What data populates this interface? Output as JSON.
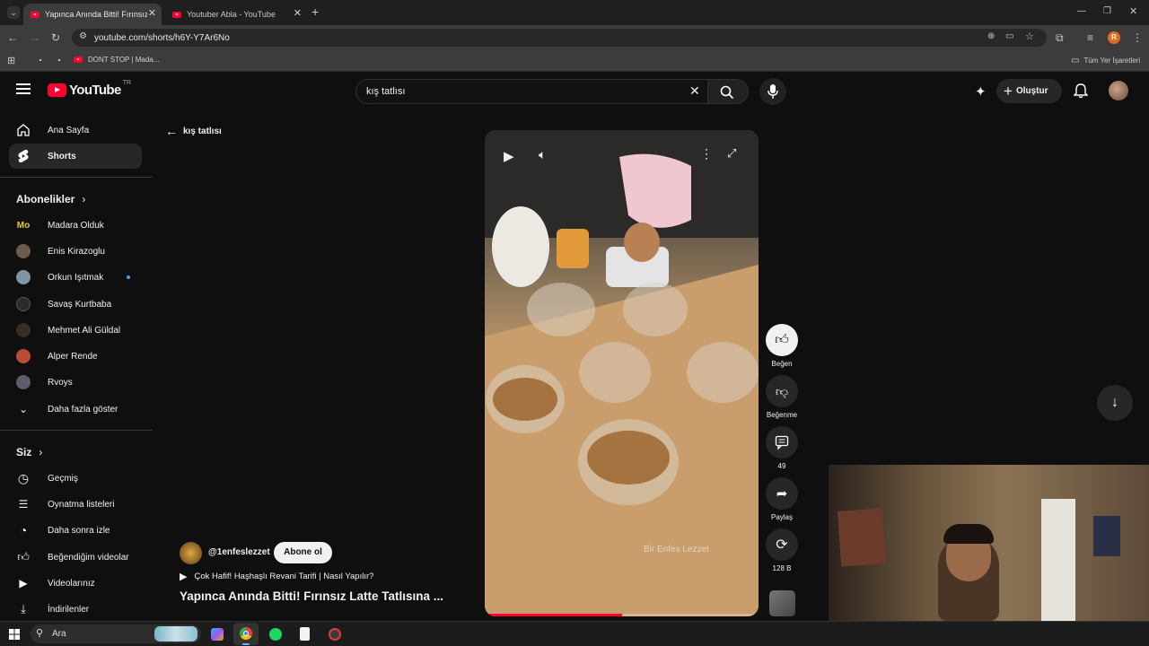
{
  "browser": {
    "tabs": [
      {
        "title": "Yapınca Anında Bitti! Fırınsız Lat",
        "active": true
      },
      {
        "title": "Youtuber Abla - YouTube",
        "active": false
      }
    ],
    "new_tab": "+",
    "url": "youtube.com/shorts/h6Y-Y7Ar6No",
    "profile_initial": "R",
    "bookmarks": [
      {
        "label": "",
        "type": "youtube"
      },
      {
        "label": "",
        "type": "youtube"
      },
      {
        "label": "DONT STOP | Mada...",
        "type": "youtube"
      }
    ],
    "all_bookmarks": "Tüm Yer İşaretleri"
  },
  "youtube": {
    "logo_text": "YouTube",
    "region": "TR",
    "search_value": "kış tatlısı",
    "create_label": "Oluştur",
    "back_label": "kış tatlısı",
    "sidebar": {
      "main": [
        {
          "label": "Ana Sayfa",
          "icon": "home-icon",
          "active": false
        },
        {
          "label": "Shorts",
          "icon": "shorts-icon",
          "active": true
        }
      ],
      "subs_title": "Abonelikler",
      "subs": [
        {
          "label": "Madara Olduk",
          "color": "#1a1a1a",
          "live": false
        },
        {
          "label": "Enis Kirazoglu",
          "color": "#6b5a4e",
          "live": false
        },
        {
          "label": "Orkun Işıtmak",
          "color": "#7f95a6",
          "live": true
        },
        {
          "label": "Savaş Kurtbaba",
          "color": "#2b2b2b",
          "live": false
        },
        {
          "label": "Mehmet Ali Güldal",
          "color": "#3a2d27",
          "live": false
        },
        {
          "label": "Alper Rende",
          "color": "#b94b37",
          "live": false
        },
        {
          "label": "Rvoys",
          "color": "#5c5c6a",
          "live": false
        }
      ],
      "show_more": "Daha fazla göster",
      "you_title": "Siz",
      "you": [
        {
          "label": "Geçmiş",
          "icon": "history-icon"
        },
        {
          "label": "Oynatma listeleri",
          "icon": "playlists-icon"
        },
        {
          "label": "Daha sonra izle",
          "icon": "watch-later-icon"
        },
        {
          "label": "Beğendiğim videolar",
          "icon": "liked-icon"
        },
        {
          "label": "Videolarınız",
          "icon": "your-videos-icon"
        },
        {
          "label": "İndirilenler",
          "icon": "downloads-icon"
        }
      ]
    },
    "short": {
      "watermark": "Bir Enfes Lezzet",
      "channel": "@1enfeslezzet",
      "subscribe": "Abone ol",
      "related_title": "Çok Hafif! Haşhaşlı Revani Tarifi | Nasıl Yapılır?",
      "title": "Yapınca Anında Bitti! Fırınsız Latte Tatlısına ...",
      "progress_fraction": 0.5
    },
    "actions": [
      {
        "label": "Beğen",
        "icon": "like-icon"
      },
      {
        "label": "Beğenme",
        "icon": "dislike-icon"
      },
      {
        "label": "49",
        "icon": "comment-icon"
      },
      {
        "label": "Paylaş",
        "icon": "share-icon"
      },
      {
        "label": "128 B",
        "icon": "remix-icon"
      }
    ]
  },
  "taskbar": {
    "search_label": "Ara"
  }
}
